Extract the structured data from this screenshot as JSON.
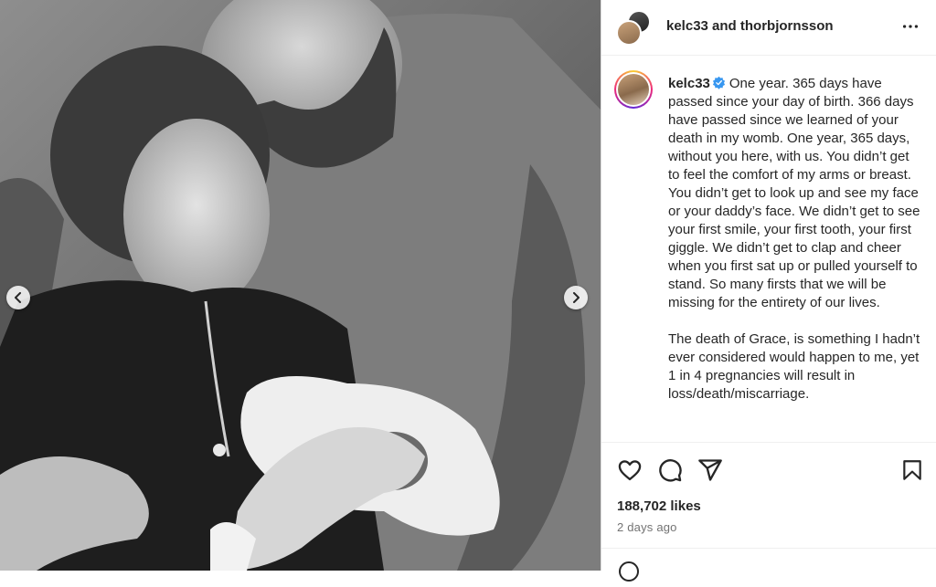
{
  "post": {
    "header_names": "kelc33 and thorbjornsson",
    "author": "kelc33",
    "caption_paragraph_1": "One year. 365 days have passed since your day of birth. 366 days have passed since we learned of your death in my womb. One year, 365 days, without you here, with us. You didn’t get to feel the comfort of my arms or breast. You didn’t get to look up and see my face or your daddy’s face. We didn’t get to see your first smile, your first tooth, your first giggle. We didn’t get to clap and cheer when you first sat up or pulled yourself to stand. So many firsts that we will be missing for the entirety of our lives.",
    "caption_paragraph_2": "The death of Grace, is something I hadn’t ever considered would happen to me, yet 1 in 4 pregnancies will result in loss/death/miscarriage.",
    "likes": "188,702 likes",
    "date": "2 days ago"
  },
  "icons": {
    "more": "more-horizontal-icon",
    "verified": "verified-badge-icon",
    "like": "heart-icon",
    "comment": "comment-icon",
    "share": "share-icon",
    "save": "bookmark-icon",
    "prev": "chevron-left-icon",
    "next": "chevron-right-icon",
    "emoji": "emoji-icon"
  },
  "colors": {
    "verified": "#3897f0",
    "text": "#262626",
    "muted": "#737373"
  }
}
